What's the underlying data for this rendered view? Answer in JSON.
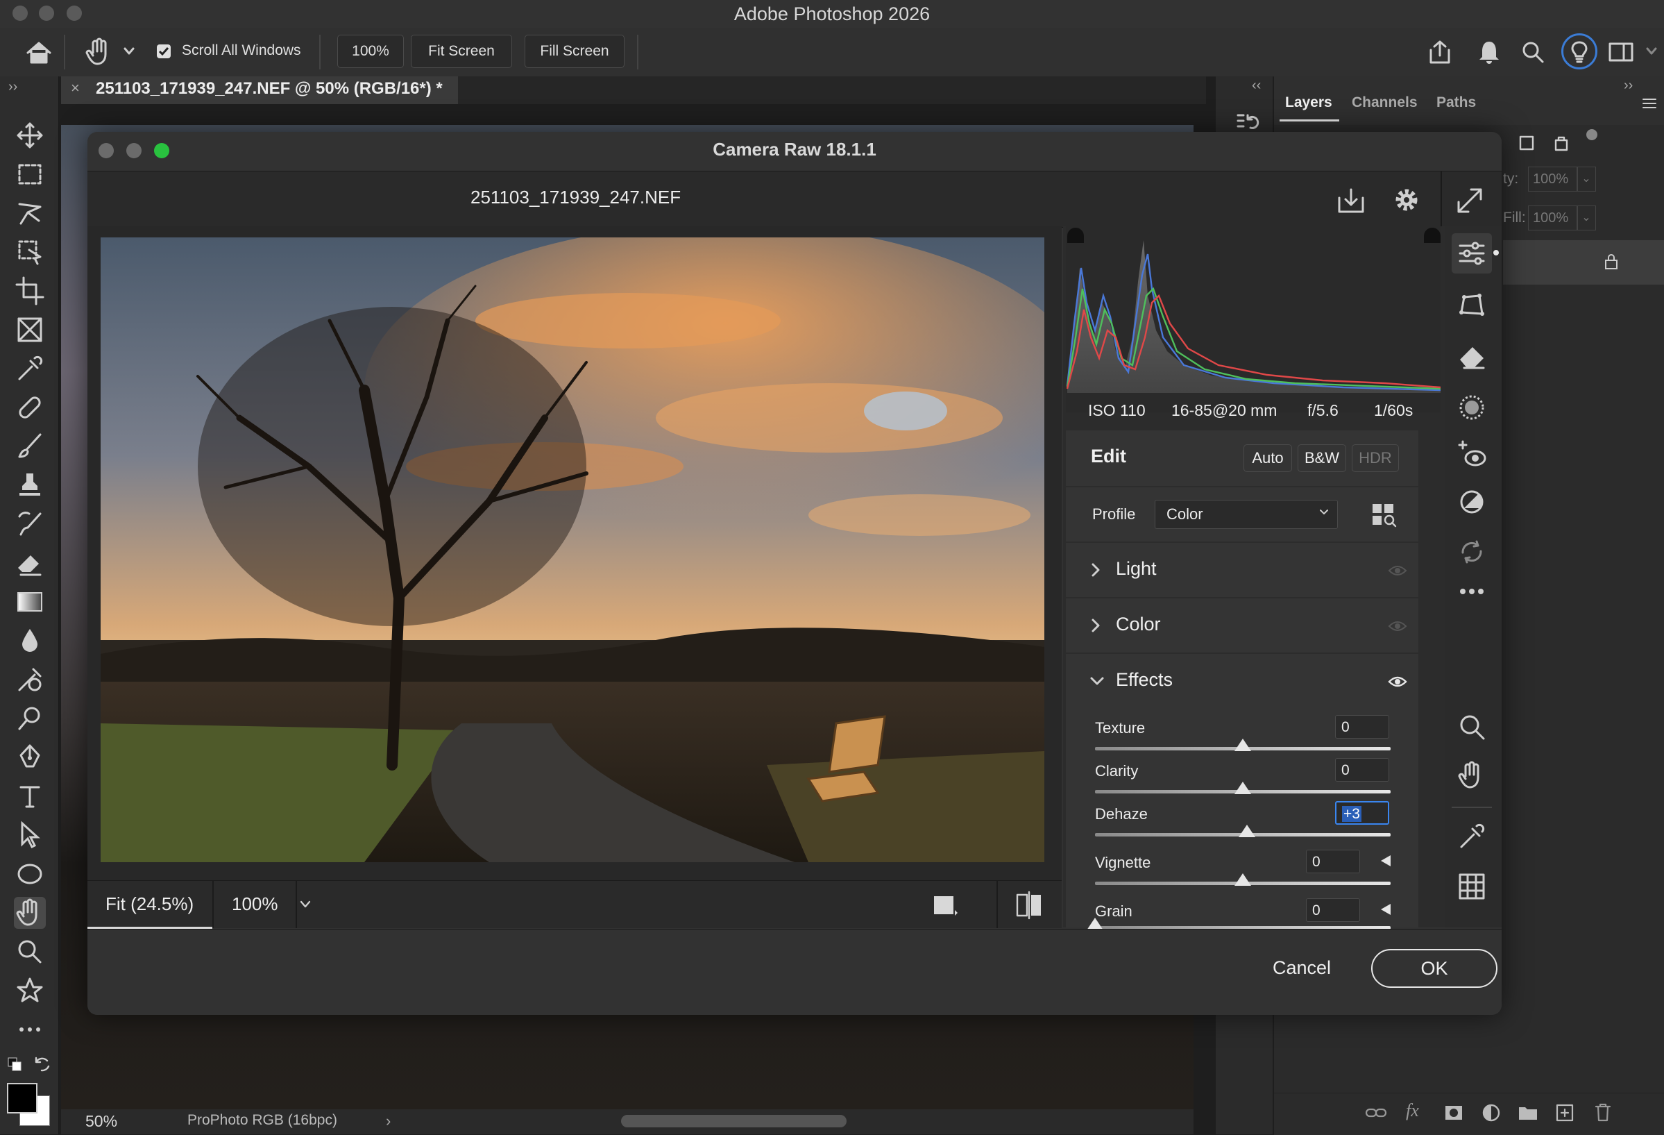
{
  "app_title": "Adobe Photoshop 2026",
  "options_bar": {
    "scroll_all_windows": "Scroll All Windows",
    "zoom": "100%",
    "fit_screen": "Fit Screen",
    "fill_screen": "Fill Screen"
  },
  "document_tab": "251103_171939_247.NEF @ 50% (RGB/16*) *",
  "status_bar": {
    "zoom": "50%",
    "profile": "ProPhoto RGB (16bpc)"
  },
  "layers_panel": {
    "tabs": [
      "Layers",
      "Channels",
      "Paths"
    ],
    "opacity_label": "ty:",
    "opacity_value": "100%",
    "fill_label": "Fill:",
    "fill_value": "100%"
  },
  "camera_raw": {
    "title": "Camera Raw 18.1.1",
    "filename": "251103_171939_247.NEF",
    "metadata": {
      "iso": "ISO 110",
      "lens": "16-85@20 mm",
      "aperture": "f/5.6",
      "shutter": "1/60s"
    },
    "edit": {
      "title": "Edit",
      "auto": "Auto",
      "bw": "B&W",
      "hdr": "HDR"
    },
    "profile": {
      "label": "Profile",
      "value": "Color"
    },
    "sections": {
      "light": "Light",
      "color": "Color",
      "effects": "Effects"
    },
    "sliders": [
      {
        "label": "Texture",
        "value": "0",
        "position": 0.5
      },
      {
        "label": "Clarity",
        "value": "0",
        "position": 0.5
      },
      {
        "label": "Dehaze",
        "value": "+3",
        "position": 0.515
      },
      {
        "label": "Vignette",
        "value": "0",
        "position": 0.5
      },
      {
        "label": "Grain",
        "value": "0",
        "position": 0.0
      }
    ],
    "preview": {
      "fit": "Fit (24.5%)",
      "zoom": "100%"
    },
    "cancel": "Cancel",
    "ok": "OK"
  }
}
